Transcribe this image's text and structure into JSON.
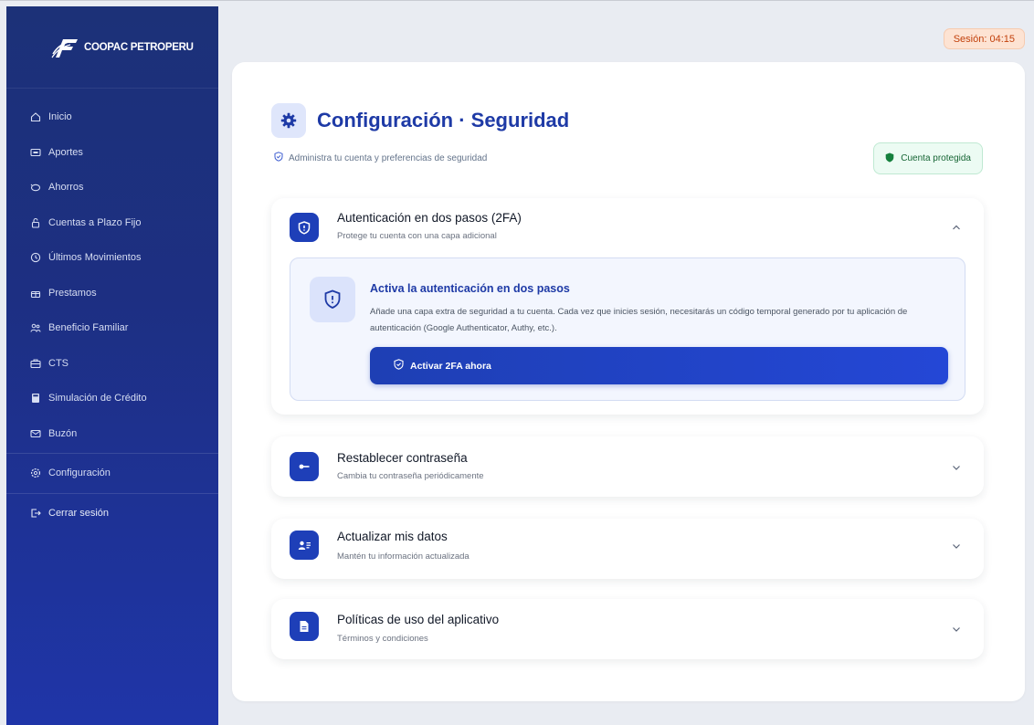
{
  "brand": {
    "name": "COOPAC PETROPERU"
  },
  "session": {
    "label": "Sesión: 04:15"
  },
  "sidebar": {
    "items": [
      {
        "label": "Inicio",
        "icon": "home-icon"
      },
      {
        "label": "Aportes",
        "icon": "wallet-icon"
      },
      {
        "label": "Ahorros",
        "icon": "piggy-bank-icon"
      },
      {
        "label": "Cuentas a Plazo Fijo",
        "icon": "lock-icon"
      },
      {
        "label": "Últimos Movimientos",
        "icon": "clock-icon"
      },
      {
        "label": "Prestamos",
        "icon": "gift-icon"
      },
      {
        "label": "Beneficio Familiar",
        "icon": "family-icon"
      },
      {
        "label": "CTS",
        "icon": "briefcase-icon"
      },
      {
        "label": "Simulación de Crédito",
        "icon": "calculator-icon"
      },
      {
        "label": "Buzón",
        "icon": "mail-icon"
      }
    ],
    "config": {
      "label": "Configuración",
      "icon": "gear-icon"
    },
    "logout": {
      "label": "Cerrar sesión",
      "icon": "logout-icon"
    }
  },
  "page": {
    "title": "Configuración · Seguridad",
    "subtitle": "Administra tu cuenta y preferencias de seguridad",
    "badge": "Cuenta protegida"
  },
  "sections": {
    "twofa": {
      "title": "Autenticación en dos pasos (2FA)",
      "desc": "Protege tu cuenta con una capa adicional",
      "panel_title": "Activa la autenticación en dos pasos",
      "panel_desc": "Añade una capa extra de seguridad a tu cuenta. Cada vez que inicies sesión, necesitarás un código temporal generado por tu aplicación de autenticación (Google Authenticator, Authy, etc.).",
      "button": "Activar 2FA ahora"
    },
    "password": {
      "title": "Restablecer contraseña",
      "desc": "Cambia tu contraseña periódicamente"
    },
    "data": {
      "title": "Actualizar mis datos",
      "desc": "Mantén tu información actualizada"
    },
    "policies": {
      "title": "Políticas de uso del aplicativo",
      "desc": "Términos y condiciones"
    }
  },
  "colors": {
    "sidebar": "#1d2f82",
    "accent": "#1e3fb8",
    "title": "#1e3aa6",
    "session_bg": "#fde3d3",
    "badge_bg": "#ecfbf3"
  }
}
